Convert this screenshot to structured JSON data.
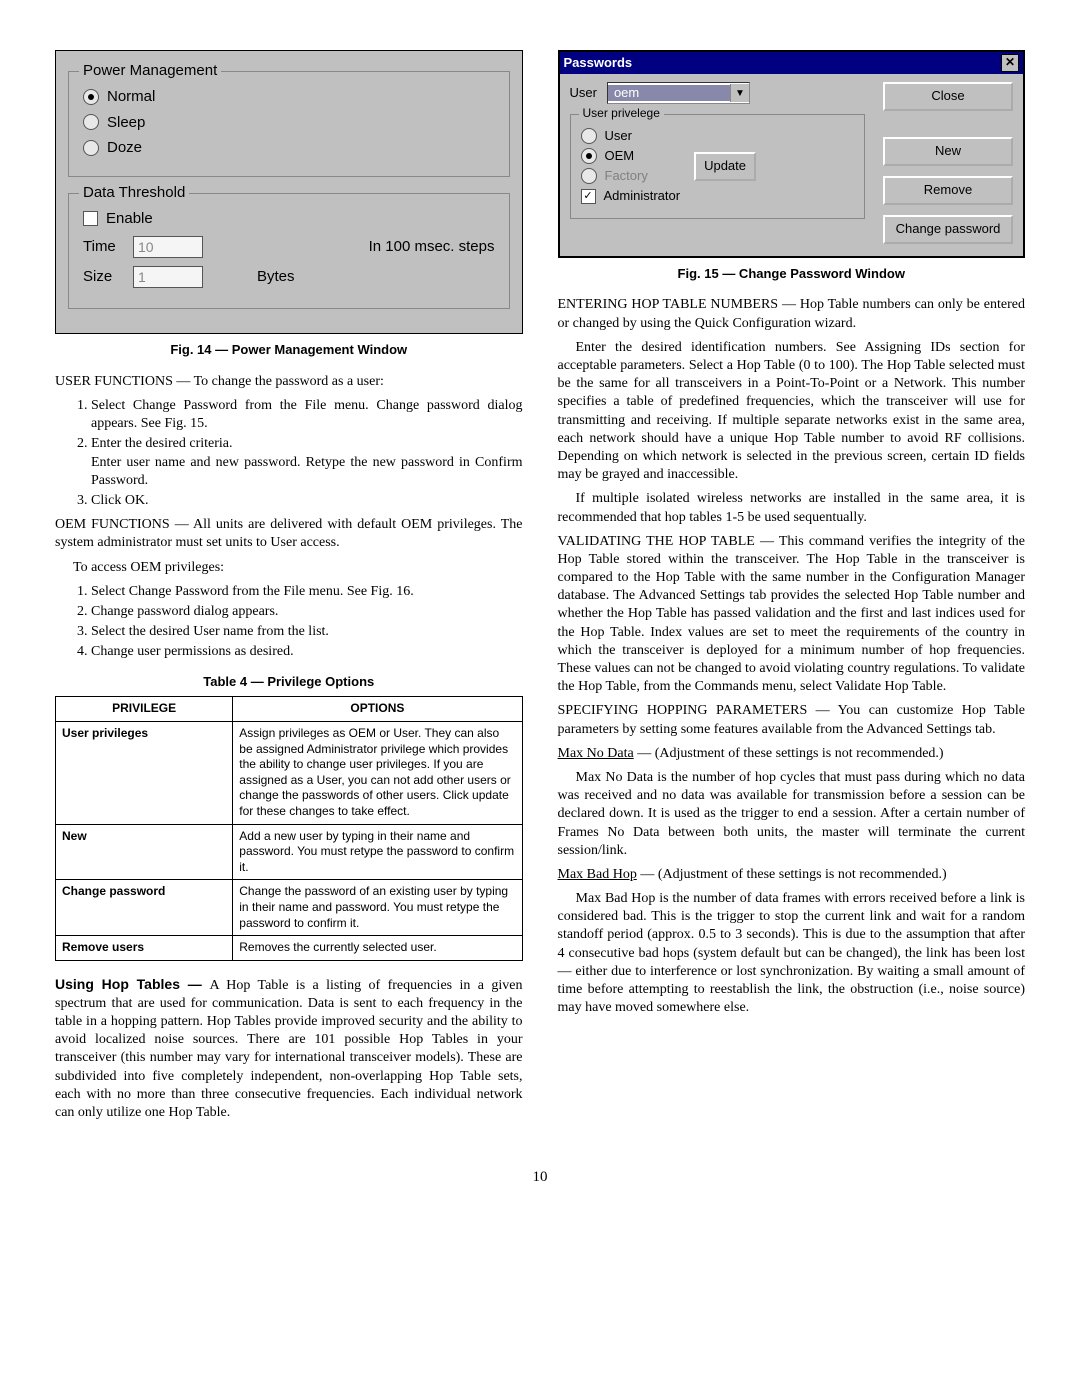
{
  "fig14": {
    "caption": "Fig. 14 — Power Management Window",
    "pm_title": "Power Management",
    "opt_normal": "Normal",
    "opt_sleep": "Sleep",
    "opt_doze": "Doze",
    "dt_title": "Data Threshold",
    "enable": "Enable",
    "time_label": "Time",
    "time_value": "10",
    "time_units": "In 100 msec. steps",
    "size_label": "Size",
    "size_value": "1",
    "size_units": "Bytes"
  },
  "left": {
    "user_fn_lead": "USER FUNCTIONS — To change the password as a user:",
    "user_steps": [
      "Select Change Password from the File menu. Change password dialog appears. See Fig. 15.",
      "Enter the desired criteria.",
      "Click OK."
    ],
    "user_step2_sub": "Enter user name and new password. Retype the new password in Confirm Password.",
    "oem_fn": "OEM FUNCTIONS — All units are delivered with default OEM privileges. The system administrator must set units to User access.",
    "oem_access": "To access OEM privileges:",
    "oem_steps": [
      "Select Change Password from the File menu. See Fig. 16.",
      "Change password dialog appears.",
      "Select the desired User name from the list.",
      "Change user permissions as desired."
    ],
    "table_caption": "Table 4 — Privilege Options",
    "th_priv": "PRIVILEGE",
    "th_opts": "OPTIONS",
    "rows": [
      {
        "k": "User privileges",
        "v": "Assign privileges as OEM or User. They can also be assigned Administrator privilege which provides the ability to change user privileges. If you are assigned as a User, you can not add other users or change the passwords of other users. Click update for these changes to take effect."
      },
      {
        "k": "New",
        "v": "Add a new user by typing in their name and password. You must retype the password to confirm it."
      },
      {
        "k": "Change password",
        "v": "Change the password of an existing user by typing in their name and password. You must retype the password to confirm it."
      },
      {
        "k": "Remove users",
        "v": "Removes the currently selected user."
      }
    ],
    "hop_heading": "Using Hop Tables — ",
    "hop_body": "A Hop Table is a listing of frequencies in a given spectrum that are used for communication. Data is sent to each frequency in the table in a hopping pattern. Hop Tables provide improved security and the ability to avoid localized noise sources. There are 101 possible Hop Tables in your transceiver (this number may vary for international transceiver models). These are subdivided into five completely independent, non-overlapping Hop Table sets, each with no more than three consecutive frequencies. Each individual network can only utilize one Hop Table."
  },
  "fig15": {
    "caption": "Fig. 15 — Change Password Window",
    "title": "Passwords",
    "user_label": "User",
    "user_value": "oem",
    "close": "Close",
    "priv_title": "User privelege",
    "r_user": "User",
    "r_oem": "OEM",
    "r_factory": "Factory",
    "c_admin": "Administrator",
    "update": "Update",
    "new": "New",
    "remove": "Remove",
    "change": "Change password"
  },
  "right": {
    "p1": "ENTERING HOP TABLE NUMBERS — Hop Table numbers can only be entered or changed by using the Quick Configuration wizard.",
    "p2": "Enter the desired identification numbers. See Assigning IDs section for acceptable parameters. Select a Hop Table (0 to 100). The Hop Table selected must be the same for all transceivers in a Point-To-Point or a Network. This number specifies a table of predefined frequencies, which the transceiver will use for transmitting and receiving. If multiple separate networks exist in the same area, each network should have a unique Hop Table number to avoid RF collisions. Depending on which network is selected in the previous screen, certain ID fields may be grayed and inaccessible.",
    "p3": "If multiple isolated wireless networks are installed in the same area, it is recommended that hop tables 1-5 be used sequentually.",
    "p4": "VALIDATING THE HOP TABLE — This command verifies the integrity of the Hop Table stored within the transceiver. The Hop Table in the transceiver is compared to the Hop Table with the same number in the Configuration Manager database. The Advanced Settings tab provides the selected Hop Table number and whether the Hop Table has passed validation and the first and last indices used for the Hop Table. Index values are set to meet the requirements of the country in which the transceiver is deployed for a minimum number of hop frequencies. These values can not be changed to avoid violating country regulations. To validate the Hop Table, from the Commands menu, select Validate Hop Table.",
    "p5": "SPECIFYING HOPPING PARAMETERS — You can customize Hop Table parameters by setting some features available from the Advanced Settings tab.",
    "p6_u": "Max No Data",
    "p6_rest": " — (Adjustment of these settings is not recommended.)",
    "p7": "Max No Data is the number of hop cycles that must pass during which no data was received and no data was available for transmission before a session can be declared down. It is used as the trigger to end a session. After a certain number of Frames No Data between both units, the master will terminate the current session/link.",
    "p8_u": "Max Bad Hop",
    "p8_rest": " — (Adjustment of these settings is not recommended.)",
    "p9": "Max Bad Hop is the number of data frames with errors received before a link is considered bad. This is the trigger to stop the current link and wait for a random standoff period (approx. 0.5 to 3 seconds). This is due to the assumption that after 4 consecutive bad hops (system default but can be changed), the link has been lost — either due to interference or lost synchronization. By waiting a small amount of time before attempting to reestablish the link, the obstruction (i.e., noise source) may have moved somewhere else."
  },
  "page": "10"
}
